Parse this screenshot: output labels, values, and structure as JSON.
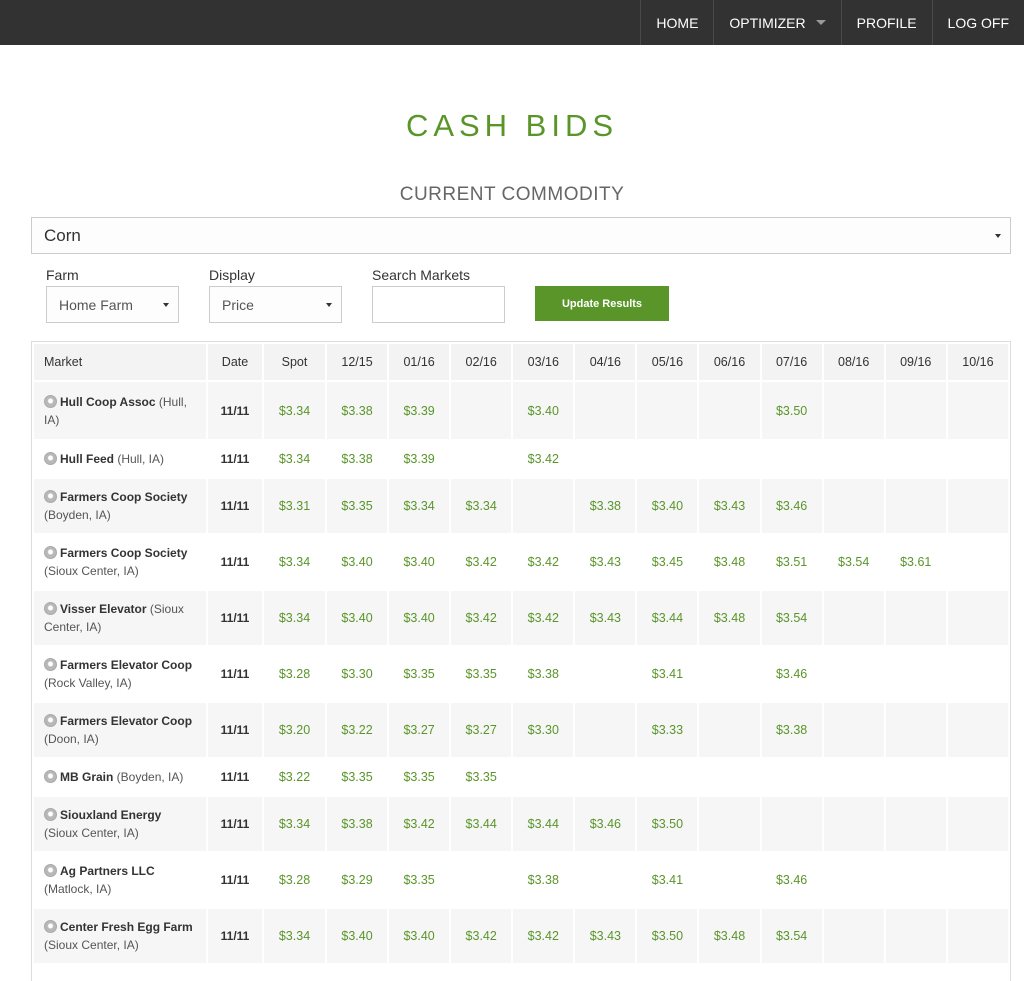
{
  "nav": {
    "home": "HOME",
    "optimizer": "OPTIMIZER",
    "profile": "PROFILE",
    "logoff": "LOG OFF"
  },
  "page": {
    "title": "CASH BIDS",
    "subtitle": "CURRENT COMMODITY"
  },
  "filters": {
    "commodity": "Corn",
    "farm_label": "Farm",
    "farm_value": "Home Farm",
    "display_label": "Display",
    "display_value": "Price",
    "search_label": "Search Markets",
    "search_value": "",
    "update_button": "Update Results"
  },
  "colors": {
    "accent_green": "#5a952a",
    "topbar": "#323232"
  },
  "table": {
    "headers": [
      "Market",
      "Date",
      "Spot",
      "12/15",
      "01/16",
      "02/16",
      "03/16",
      "04/16",
      "05/16",
      "06/16",
      "07/16",
      "08/16",
      "09/16",
      "10/16"
    ],
    "rows": [
      {
        "name": "Hull Coop Assoc",
        "location": "(Hull, IA)",
        "date": "11/11",
        "prices": [
          "$3.34",
          "$3.38",
          "$3.39",
          "",
          "$3.40",
          "",
          "",
          "",
          "$3.50",
          "",
          "",
          ""
        ]
      },
      {
        "name": "Hull Feed",
        "location": "(Hull, IA)",
        "date": "11/11",
        "prices": [
          "$3.34",
          "$3.38",
          "$3.39",
          "",
          "$3.42",
          "",
          "",
          "",
          "",
          "",
          "",
          ""
        ]
      },
      {
        "name": "Farmers Coop Society",
        "location": "(Boyden, IA)",
        "date": "11/11",
        "prices": [
          "$3.31",
          "$3.35",
          "$3.34",
          "$3.34",
          "",
          "$3.38",
          "$3.40",
          "$3.43",
          "$3.46",
          "",
          "",
          ""
        ]
      },
      {
        "name": "Farmers Coop Society",
        "location": "(Sioux Center, IA)",
        "date": "11/11",
        "prices": [
          "$3.34",
          "$3.40",
          "$3.40",
          "$3.42",
          "$3.42",
          "$3.43",
          "$3.45",
          "$3.48",
          "$3.51",
          "$3.54",
          "$3.61",
          ""
        ]
      },
      {
        "name": "Visser Elevator",
        "location": "(Sioux Center, IA)",
        "date": "11/11",
        "prices": [
          "$3.34",
          "$3.40",
          "$3.40",
          "$3.42",
          "$3.42",
          "$3.43",
          "$3.44",
          "$3.48",
          "$3.54",
          "",
          "",
          ""
        ]
      },
      {
        "name": "Farmers Elevator Coop",
        "location": "(Rock Valley, IA)",
        "date": "11/11",
        "prices": [
          "$3.28",
          "$3.30",
          "$3.35",
          "$3.35",
          "$3.38",
          "",
          "$3.41",
          "",
          "$3.46",
          "",
          "",
          ""
        ]
      },
      {
        "name": "Farmers Elevator Coop",
        "location": "(Doon, IA)",
        "date": "11/11",
        "prices": [
          "$3.20",
          "$3.22",
          "$3.27",
          "$3.27",
          "$3.30",
          "",
          "$3.33",
          "",
          "$3.38",
          "",
          "",
          ""
        ]
      },
      {
        "name": "MB Grain",
        "location": "(Boyden, IA)",
        "date": "11/11",
        "prices": [
          "$3.22",
          "$3.35",
          "$3.35",
          "$3.35",
          "",
          "",
          "",
          "",
          "",
          "",
          "",
          ""
        ]
      },
      {
        "name": "Siouxland Energy",
        "location": "(Sioux Center, IA)",
        "date": "11/11",
        "prices": [
          "$3.34",
          "$3.38",
          "$3.42",
          "$3.44",
          "$3.44",
          "$3.46",
          "$3.50",
          "",
          "",
          "",
          "",
          ""
        ]
      },
      {
        "name": "Ag Partners LLC",
        "location": "(Matlock, IA)",
        "date": "11/11",
        "prices": [
          "$3.28",
          "$3.29",
          "$3.35",
          "",
          "$3.38",
          "",
          "$3.41",
          "",
          "$3.46",
          "",
          "",
          ""
        ]
      },
      {
        "name": "Center Fresh Egg Farm",
        "location": "(Sioux Center, IA)",
        "date": "11/11",
        "prices": [
          "$3.34",
          "$3.40",
          "$3.40",
          "$3.42",
          "$3.42",
          "$3.43",
          "$3.50",
          "$3.48",
          "$3.54",
          "",
          "",
          ""
        ]
      },
      {
        "name": "",
        "location": "",
        "date": "",
        "prices": [
          "",
          "",
          "",
          "",
          "",
          "",
          "",
          "",
          "",
          "",
          "",
          ""
        ]
      }
    ]
  }
}
